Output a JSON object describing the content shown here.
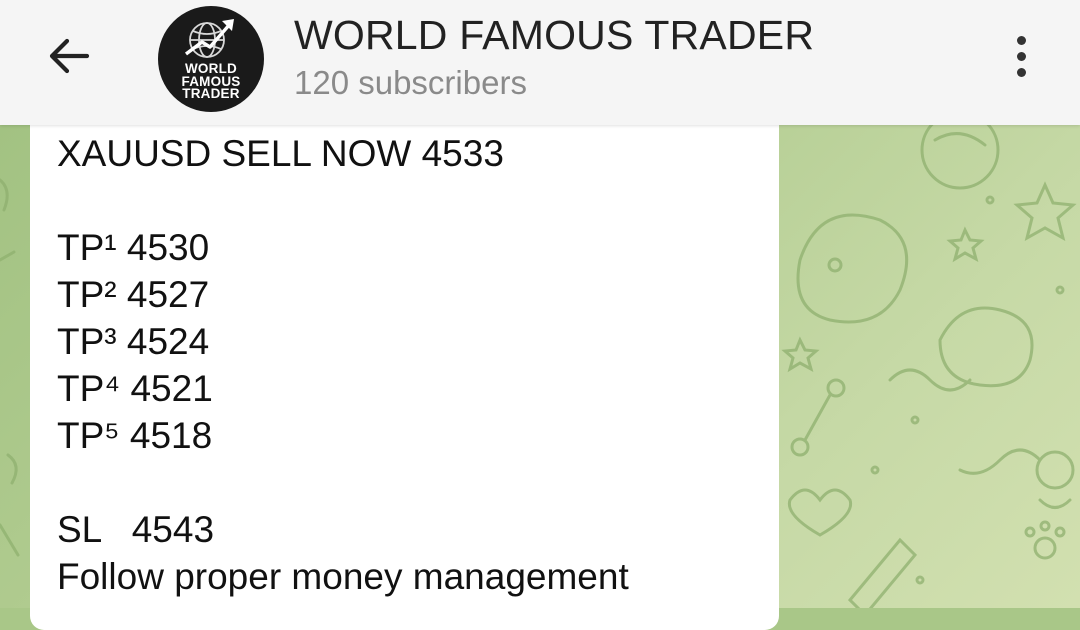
{
  "header": {
    "title": "WORLD FAMOUS TRADER",
    "subtitle": "120 subscribers",
    "avatar_text_lines": [
      "WORLD",
      "FAMOUS",
      "TRADER"
    ]
  },
  "icons": {
    "back": "arrow-left-icon",
    "menu": "more-vertical-icon",
    "avatar": "globe-trend-arrow-logo"
  },
  "message": {
    "signal": "XAUUSD SELL NOW 4533",
    "tp1": "TP¹ 4530",
    "tp2": "TP² 4527",
    "tp3": "TP³ 4524",
    "tp4": "TP⁴ 4521",
    "tp5": "TP⁵ 4518",
    "sl": "SL   4543",
    "note": "Follow proper money management"
  },
  "colors": {
    "header_bg": "#f5f5f5",
    "chat_bg": "#a9c788",
    "bubble_bg": "#ffffff",
    "text": "#111111",
    "subtitle": "#8a8a8a"
  }
}
